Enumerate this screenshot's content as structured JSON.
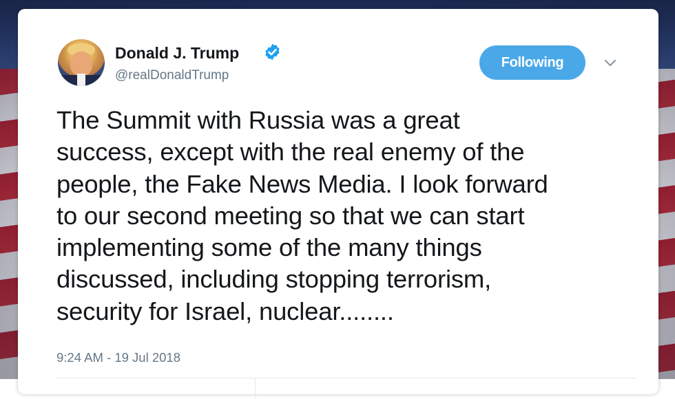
{
  "tweet": {
    "author": {
      "display_name": "Donald J. Trump",
      "handle": "@realDonaldTrump",
      "verified": true
    },
    "follow_button_label": "Following",
    "text_lines": [
      "The Summit with Russia was a great",
      "success, except with the real enemy of the",
      "people, the Fake News Media. I look forward",
      "to our second meeting so that we can start",
      "implementing some of the many things",
      "discussed, including stopping terrorism,",
      "security for Israel, nuclear........"
    ],
    "timestamp": "9:24 AM - 19 Jul 2018"
  },
  "icons": {
    "verified": "verified-badge-icon",
    "menu": "chevron-down-icon"
  },
  "colors": {
    "accent": "#4aa8e8",
    "verified": "#1da1f2",
    "text": "#14171a",
    "secondary_text": "#657786"
  }
}
